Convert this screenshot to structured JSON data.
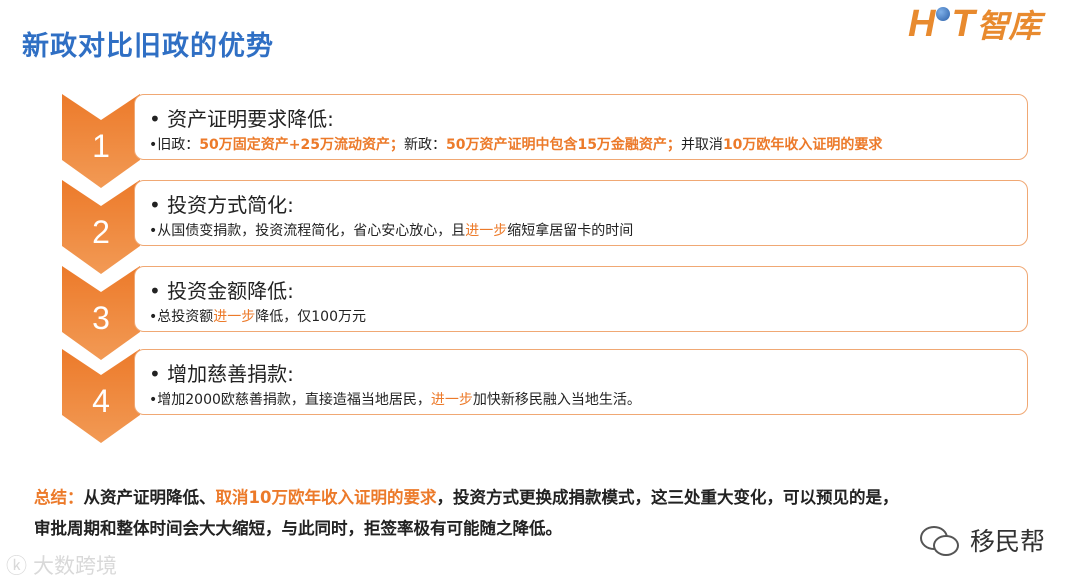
{
  "header": {
    "title": "新政对比旧政的优势"
  },
  "logo": {
    "h": "H",
    "t": "T",
    "name": "智库"
  },
  "rows": [
    {
      "number": "1",
      "heading": "资产证明要求降低:",
      "detail_parts": [
        {
          "text": "旧政：",
          "hl": false
        },
        {
          "text": "50万固定资产+25万流动资产；",
          "hl": "bold"
        },
        {
          "text": "新政：",
          "hl": false
        },
        {
          "text": "50万资产证明中包含15万金融资产；",
          "hl": "bold"
        },
        {
          "text": "并取消",
          "hl": false
        },
        {
          "text": "10万欧年收入证明的要求",
          "hl": "bold"
        }
      ]
    },
    {
      "number": "2",
      "heading": "投资方式简化:",
      "detail_parts": [
        {
          "text": "从国债变捐款，投资流程简化，省心安心放心，且",
          "hl": false
        },
        {
          "text": "进一步",
          "hl": "normal"
        },
        {
          "text": "缩短拿居留卡的时间",
          "hl": false
        }
      ]
    },
    {
      "number": "3",
      "heading": "投资金额降低:",
      "detail_parts": [
        {
          "text": "总投资额",
          "hl": false
        },
        {
          "text": "进一步",
          "hl": "normal"
        },
        {
          "text": "降低，仅100万元",
          "hl": false
        }
      ]
    },
    {
      "number": "4",
      "heading": "增加慈善捐款:",
      "detail_parts": [
        {
          "text": "增加2000欧慈善捐款，直接造福当地居民，",
          "hl": false
        },
        {
          "text": "进一步",
          "hl": "normal"
        },
        {
          "text": "加快新移民融入当地生活。",
          "hl": false
        }
      ]
    }
  ],
  "summary": {
    "label": "总结：",
    "line1_a": "从资产证明降低、",
    "line1_hl": "取消10万欧年收入证明的要求",
    "line1_b": "，投资方式更换成捐款模式，这三处重大变化，可以预见的是，",
    "line2": "审批周期和整体时间会大大缩短，与此同时，拒签率极有可能随之降低。"
  },
  "watermarks": {
    "left": "大数跨境",
    "left_mark": "ⓚ",
    "right": "移民帮"
  },
  "colors": {
    "accent": "#ec7a2a",
    "title": "#2f6fc4",
    "border": "#f0a874"
  }
}
